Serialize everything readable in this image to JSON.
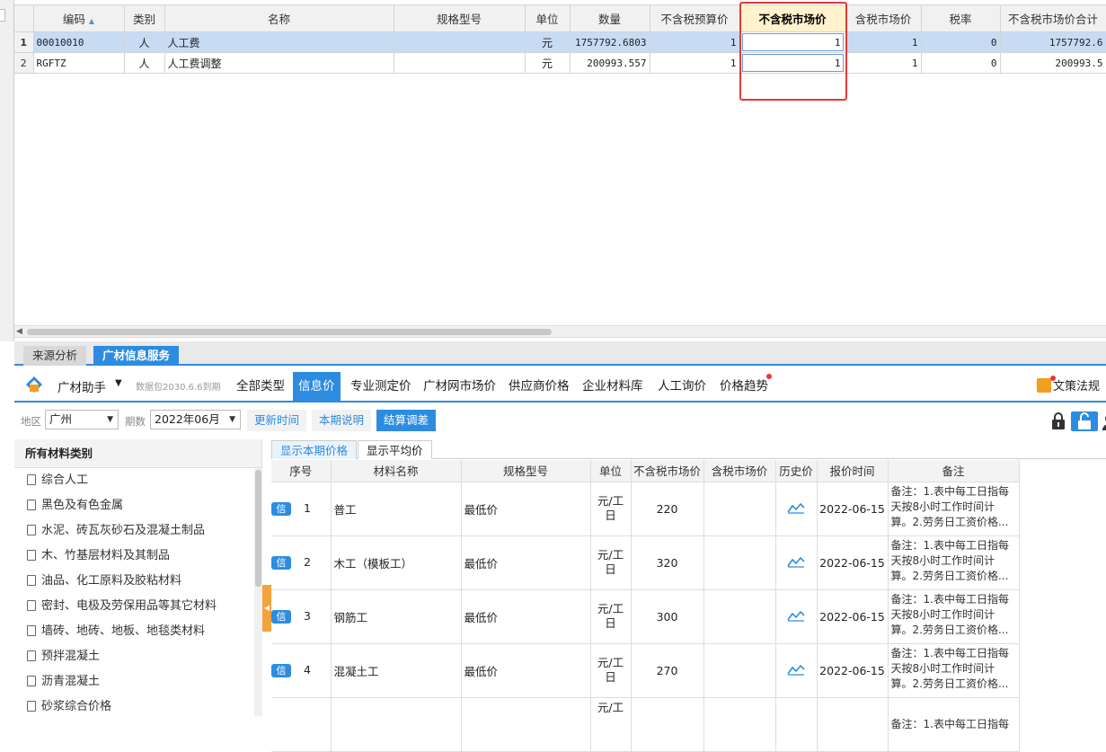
{
  "grid": {
    "headers": [
      "编码",
      "类别",
      "名称",
      "规格型号",
      "单位",
      "数量",
      "不含税预算价",
      "不含税市场价",
      "含税市场价",
      "税率",
      "不含税市场价合计"
    ],
    "rows": [
      {
        "rn": "1",
        "code": "00010010",
        "type": "人",
        "name": "人工费",
        "spec": "",
        "unit": "元",
        "qty": "1757792.6803",
        "budget": "1",
        "market": "1",
        "taxmarket": "1",
        "rate": "0",
        "total": "1757792.6"
      },
      {
        "rn": "2",
        "code": "RGFTZ",
        "type": "人",
        "name": "人工费调整",
        "spec": "",
        "unit": "元",
        "qty": "200993.557",
        "budget": "1",
        "market": "1",
        "taxmarket": "1",
        "rate": "0",
        "total": "200993.5"
      }
    ]
  },
  "bottom_tabs": [
    "来源分析",
    "广材信息服务"
  ],
  "toolbar": {
    "brand": "广材助手",
    "package": "数据包2030.6.6到期",
    "nav": [
      "全部类型",
      "信息价",
      "专业测定价",
      "广材网市场价",
      "供应商价格",
      "企业材料库",
      "人工询价",
      "价格趋势"
    ],
    "active_nav": "信息价",
    "doc_link": "文策法规"
  },
  "filter": {
    "region_label": "地区",
    "region_value": "广州",
    "period_label": "期数",
    "period_value": "2022年06月",
    "buttons": [
      "更新时间",
      "本期说明",
      "结算调差"
    ]
  },
  "sidebar": {
    "title": "所有材料类别",
    "items": [
      "综合人工",
      "黑色及有色金属",
      "水泥、砖瓦灰砂石及混凝土制品",
      "木、竹基层材料及其制品",
      "油品、化工原料及胶粘材料",
      "密封、电极及劳保用品等其它材料",
      "墙砖、地砖、地板、地毯类材料",
      "预拌混凝土",
      "沥青混凝土",
      "砂浆综合价格"
    ]
  },
  "subtabs": [
    "显示本期价格",
    "显示平均价"
  ],
  "price_table": {
    "headers": [
      "序号",
      "材料名称",
      "规格型号",
      "单位",
      "不含税市场价",
      "含税市场价",
      "历史价",
      "报价时间",
      "备注"
    ],
    "badge": "信",
    "rows": [
      {
        "no": "1",
        "name": "普工",
        "spec": "最低价",
        "unit": "元/工日",
        "price": "220",
        "taxprice": "",
        "date": "2022-06-15",
        "note": "备注：1.表中每工日指每天按8小时工作时间计算。2.劳务日工资价格..."
      },
      {
        "no": "2",
        "name": "木工（模板工）",
        "spec": "最低价",
        "unit": "元/工日",
        "price": "320",
        "taxprice": "",
        "date": "2022-06-15",
        "note": "备注：1.表中每工日指每天按8小时工作时间计算。2.劳务日工资价格..."
      },
      {
        "no": "3",
        "name": "钢筋工",
        "spec": "最低价",
        "unit": "元/工日",
        "price": "300",
        "taxprice": "",
        "date": "2022-06-15",
        "note": "备注：1.表中每工日指每天按8小时工作时间计算。2.劳务日工资价格..."
      },
      {
        "no": "4",
        "name": "混凝土工",
        "spec": "最低价",
        "unit": "元/工日",
        "price": "270",
        "taxprice": "",
        "date": "2022-06-15",
        "note": "备注：1.表中每工日指每天按8小时工作时间计算。2.劳务日工资价格..."
      },
      {
        "no": "",
        "name": "",
        "spec": "",
        "unit": "元/工",
        "price": "",
        "taxprice": "",
        "date": "",
        "note": "备注：1.表中每工日指每"
      }
    ]
  }
}
